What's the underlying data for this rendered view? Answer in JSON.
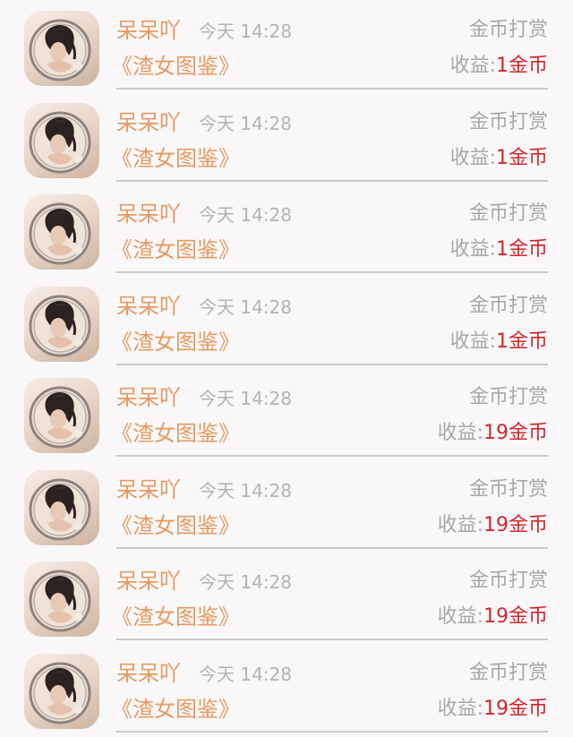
{
  "colors": {
    "accent": "#e69a62",
    "earning": "#d2262e",
    "muted": "#a8a8a8",
    "divider": "#c9c9c9",
    "background": "#f9f7f8"
  },
  "records": [
    {
      "user": "呆呆吖",
      "time": "今天 14:28",
      "type": "金币打赏",
      "book": "《渣女图鉴》",
      "earnings_label": "收益:",
      "earnings_value": "1金币"
    },
    {
      "user": "呆呆吖",
      "time": "今天 14:28",
      "type": "金币打赏",
      "book": "《渣女图鉴》",
      "earnings_label": "收益:",
      "earnings_value": "1金币"
    },
    {
      "user": "呆呆吖",
      "time": "今天 14:28",
      "type": "金币打赏",
      "book": "《渣女图鉴》",
      "earnings_label": "收益:",
      "earnings_value": "1金币"
    },
    {
      "user": "呆呆吖",
      "time": "今天 14:28",
      "type": "金币打赏",
      "book": "《渣女图鉴》",
      "earnings_label": "收益:",
      "earnings_value": "1金币"
    },
    {
      "user": "呆呆吖",
      "time": "今天 14:28",
      "type": "金币打赏",
      "book": "《渣女图鉴》",
      "earnings_label": "收益:",
      "earnings_value": "19金币"
    },
    {
      "user": "呆呆吖",
      "time": "今天 14:28",
      "type": "金币打赏",
      "book": "《渣女图鉴》",
      "earnings_label": "收益:",
      "earnings_value": "19金币"
    },
    {
      "user": "呆呆吖",
      "time": "今天 14:28",
      "type": "金币打赏",
      "book": "《渣女图鉴》",
      "earnings_label": "收益:",
      "earnings_value": "19金币"
    },
    {
      "user": "呆呆吖",
      "time": "今天 14:28",
      "type": "金币打赏",
      "book": "《渣女图鉴》",
      "earnings_label": "收益:",
      "earnings_value": "19金币"
    }
  ]
}
